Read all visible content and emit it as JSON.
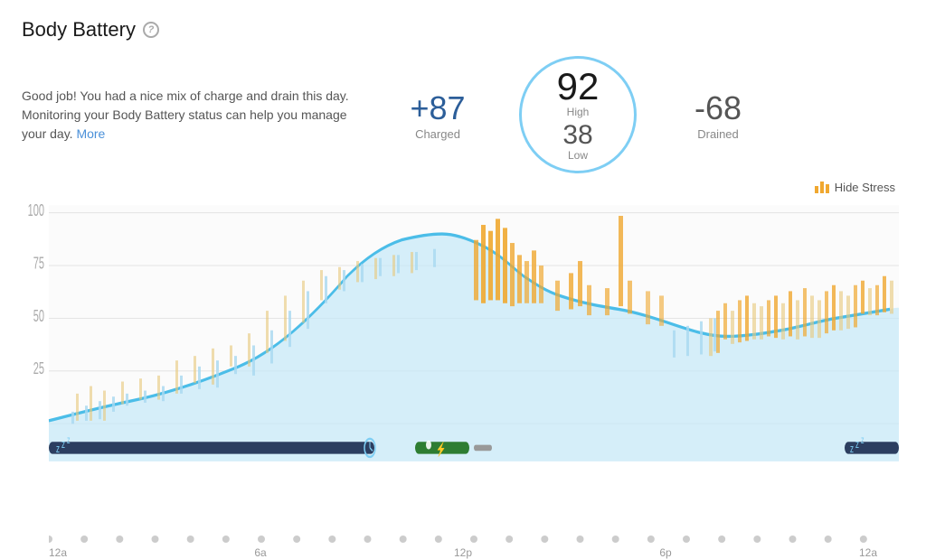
{
  "header": {
    "title": "Body Battery",
    "help_icon": "?"
  },
  "description": {
    "text": "Good job! You had a nice mix of charge and drain this day. Monitoring your Body Battery status can help you manage your day.",
    "more_label": "More"
  },
  "stats": {
    "charged_value": "+87",
    "charged_label": "Charged",
    "high_value": "92",
    "high_label": "High",
    "low_value": "38",
    "low_label": "Low",
    "drained_value": "-68",
    "drained_label": "Drained"
  },
  "hide_stress": {
    "label": "Hide Stress"
  },
  "time_labels": [
    "12a",
    "6a",
    "12p",
    "6p",
    "12a"
  ],
  "chart": {
    "y_labels": [
      "100",
      "75",
      "50",
      "25"
    ],
    "accent_color": "#7ecef4",
    "stress_color": "#f0a830",
    "body_battery_color": "#a8d8f0"
  }
}
